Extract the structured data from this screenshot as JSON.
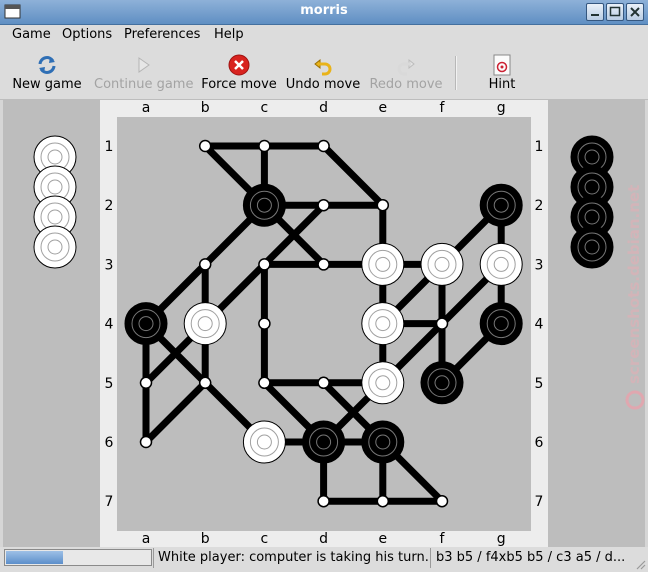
{
  "window": {
    "title": "morris"
  },
  "menu": [
    "Game",
    "Options",
    "Preferences",
    "Help"
  ],
  "toolbar": {
    "new_game": "New game",
    "continue_game": "Continue game",
    "force_move": "Force move",
    "undo_move": "Undo move",
    "redo_move": "Redo move",
    "hint": "Hint"
  },
  "board": {
    "columns": [
      "a",
      "b",
      "c",
      "d",
      "e",
      "f",
      "g"
    ],
    "rows": [
      "1",
      "2",
      "3",
      "4",
      "5",
      "6",
      "7"
    ],
    "background_color": "#bdbdbd",
    "frame_color": "#ededed",
    "positions": [
      {
        "id": "b1",
        "piece": "empty"
      },
      {
        "id": "c1",
        "piece": "empty"
      },
      {
        "id": "d1",
        "piece": "empty"
      },
      {
        "id": "c2",
        "piece": "black"
      },
      {
        "id": "d2",
        "piece": "empty"
      },
      {
        "id": "e2",
        "piece": "empty"
      },
      {
        "id": "g2",
        "piece": "black"
      },
      {
        "id": "b3",
        "piece": "empty"
      },
      {
        "id": "c3",
        "piece": "empty"
      },
      {
        "id": "d3",
        "piece": "empty"
      },
      {
        "id": "e3",
        "piece": "white"
      },
      {
        "id": "f3",
        "piece": "white"
      },
      {
        "id": "g3",
        "piece": "white"
      },
      {
        "id": "a4",
        "piece": "black"
      },
      {
        "id": "b4",
        "piece": "white"
      },
      {
        "id": "c4",
        "piece": "empty"
      },
      {
        "id": "e4",
        "piece": "white"
      },
      {
        "id": "f4",
        "piece": "empty"
      },
      {
        "id": "g4",
        "piece": "black"
      },
      {
        "id": "a5",
        "piece": "empty"
      },
      {
        "id": "b5",
        "piece": "empty"
      },
      {
        "id": "c5",
        "piece": "empty"
      },
      {
        "id": "d5",
        "piece": "empty"
      },
      {
        "id": "e5",
        "piece": "white"
      },
      {
        "id": "f5",
        "piece": "black"
      },
      {
        "id": "a6",
        "piece": "empty"
      },
      {
        "id": "c6",
        "piece": "white"
      },
      {
        "id": "d6",
        "piece": "black"
      },
      {
        "id": "e6",
        "piece": "black"
      },
      {
        "id": "d7",
        "piece": "empty"
      },
      {
        "id": "e7",
        "piece": "empty"
      },
      {
        "id": "f7",
        "piece": "empty"
      }
    ],
    "lines": [
      [
        "b1",
        "c1"
      ],
      [
        "c1",
        "d1"
      ],
      [
        "b1",
        "c2"
      ],
      [
        "c1",
        "c2"
      ],
      [
        "d1",
        "e2"
      ],
      [
        "c2",
        "d2"
      ],
      [
        "d2",
        "e2"
      ],
      [
        "c2",
        "b3"
      ],
      [
        "c2",
        "d3"
      ],
      [
        "d2",
        "c3"
      ],
      [
        "e2",
        "e3"
      ],
      [
        "g2",
        "f3"
      ],
      [
        "g2",
        "g3"
      ],
      [
        "b3",
        "a4"
      ],
      [
        "b3",
        "b4"
      ],
      [
        "c3",
        "d3"
      ],
      [
        "d3",
        "e3"
      ],
      [
        "c3",
        "b4"
      ],
      [
        "c3",
        "c4"
      ],
      [
        "e3",
        "f3"
      ],
      [
        "e3",
        "e4"
      ],
      [
        "f3",
        "e4"
      ],
      [
        "f3",
        "f4"
      ],
      [
        "g3",
        "f4"
      ],
      [
        "g3",
        "g4"
      ],
      [
        "a4",
        "a5"
      ],
      [
        "a4",
        "b5"
      ],
      [
        "b4",
        "a5"
      ],
      [
        "b4",
        "b5"
      ],
      [
        "c4",
        "c5"
      ],
      [
        "e4",
        "e5"
      ],
      [
        "e4",
        "f4"
      ],
      [
        "f4",
        "f5"
      ],
      [
        "f4",
        "e5"
      ],
      [
        "g4",
        "f5"
      ],
      [
        "a5",
        "a6"
      ],
      [
        "b5",
        "a6"
      ],
      [
        "c5",
        "d5"
      ],
      [
        "d5",
        "e5"
      ],
      [
        "b5",
        "c6"
      ],
      [
        "c5",
        "d6"
      ],
      [
        "d5",
        "e6"
      ],
      [
        "e5",
        "d6"
      ],
      [
        "c6",
        "d6"
      ],
      [
        "d6",
        "e6"
      ],
      [
        "d6",
        "d7"
      ],
      [
        "e6",
        "e7"
      ],
      [
        "e6",
        "f7"
      ],
      [
        "d7",
        "e7"
      ],
      [
        "e7",
        "f7"
      ]
    ]
  },
  "white_reserve_count": 4,
  "black_reserve_count": 4,
  "status": {
    "progress_fraction": 0.39,
    "message": "White player: computer is taking his turn...",
    "moves": "b3 b5 / f4xb5 b5 / c3 a5 / d..."
  },
  "watermark": "screenshots.debian.net"
}
